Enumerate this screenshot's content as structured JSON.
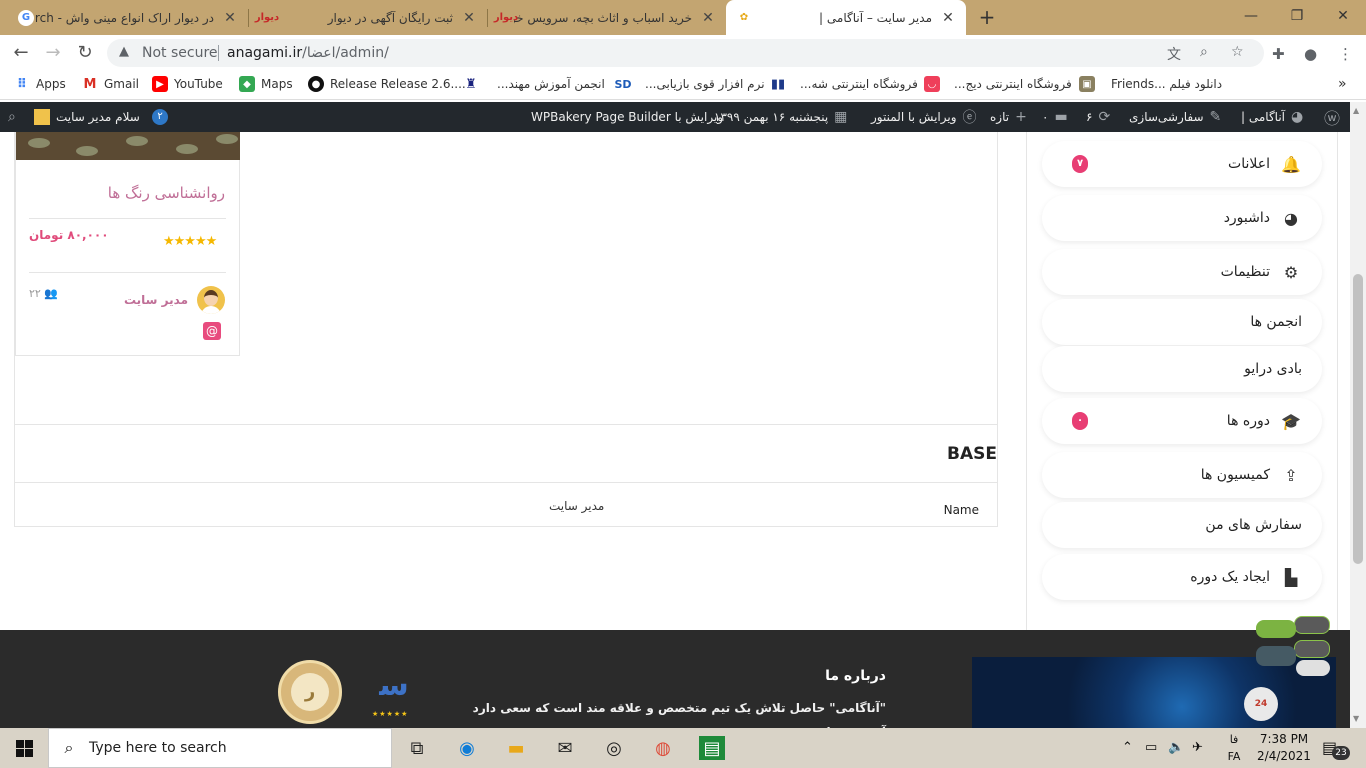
{
  "browser": {
    "tabs": [
      {
        "title": "در دیوار اراک انواع مینی واش - rch",
        "favicon": "google"
      },
      {
        "title": "ثبت رایگان آگهی در دیوار",
        "favicon": "دیوار"
      },
      {
        "title": "خرید اسباب و اثاث بچه، سرویس خو",
        "favicon": "دیوار"
      },
      {
        "title": "مدیر سایت – آناگامی |",
        "favicon": "site",
        "active": true
      }
    ],
    "new_tab": "+",
    "window_controls": {
      "minimize": "—",
      "restore": "❐",
      "close": "✕"
    },
    "address": {
      "security": "Not secure",
      "host": "anagami.ir",
      "path": "/اعضا/admin/"
    },
    "bookmarks": [
      {
        "label": "Apps",
        "icon": "apps-grid-icon"
      },
      {
        "label": "Gmail",
        "icon": "gmail-icon"
      },
      {
        "label": "YouTube",
        "icon": "youtube-icon"
      },
      {
        "label": "Maps",
        "icon": "maps-icon"
      },
      {
        "label": "Release Release 2.6....",
        "icon": "github-icon"
      },
      {
        "label": "انجمن آموزش مهند...",
        "icon": "forum-icon"
      },
      {
        "label": "نرم افزار قوی بازیابی...",
        "icon": "recovery-icon"
      },
      {
        "label": "فروشگاه اینترنتی شه...",
        "icon": "shop-icon"
      },
      {
        "label": "فروشگاه اینترنتی دیج...",
        "icon": "digikala-icon"
      },
      {
        "label": "Friends... دانلود فیلم",
        "icon": "film-icon"
      }
    ],
    "more_bookmarks": "»"
  },
  "adminbar": {
    "site_name": "آناگامی |",
    "customize": "سفارشی‌سازی",
    "updates_count": "۶",
    "comments_count": "۰",
    "new_label": "تازه",
    "elementor": "ویرایش با المنتور",
    "date": "پنجشنبه ۱۶ بهمن ۱۳۹۹",
    "wpbakery": "ویرایش با WPBakery Page Builder",
    "greeting": "سلام مدیر سایت",
    "notif_count": "۲"
  },
  "card": {
    "title": "روانشناسی رنگ ها",
    "price": "۸۰,۰۰۰ تومان",
    "stars": "★★★★★",
    "rating": 5,
    "students": "۲۲",
    "author": "مدیر سایت"
  },
  "base_section": {
    "title": "BASE",
    "name_label": "Name",
    "name_value": "مدیر سایت"
  },
  "sidebar": {
    "items": [
      {
        "label": "اعلانات",
        "icon": "bell-icon",
        "badge": "۷"
      },
      {
        "label": "داشبورد",
        "icon": "dashboard-icon"
      },
      {
        "label": "تنظیمات",
        "icon": "gear-icon"
      },
      {
        "label": "انجمن ها",
        "icon": ""
      },
      {
        "label": "بادی درایو",
        "icon": ""
      },
      {
        "label": "دوره ها",
        "icon": "graduation-cap-icon",
        "badge": "۰"
      },
      {
        "label": "کمیسیون ها",
        "icon": "upload-icon"
      },
      {
        "label": "سفارش های من",
        "icon": ""
      },
      {
        "label": "ایجاد یک دوره",
        "icon": "file-icon"
      }
    ]
  },
  "footer": {
    "about_title": "درباره ما",
    "about_text": "\"آناگامی\" حاصل تلاش یک تیم متخصص و علاقه مند است که سعی دارد آموزش ها"
  },
  "taskbar": {
    "search_placeholder": "Type here to search",
    "lang_script": "فا",
    "lang_code": "FA",
    "time": "7:38 PM",
    "date": "2/4/2021",
    "notifications": "23"
  },
  "colors": {
    "tabstrip": "#c3a571",
    "adminbar": "#23282d",
    "accent_pink": "#e83e74",
    "card_title": "#c06f97",
    "footer": "#2b2b2b"
  }
}
